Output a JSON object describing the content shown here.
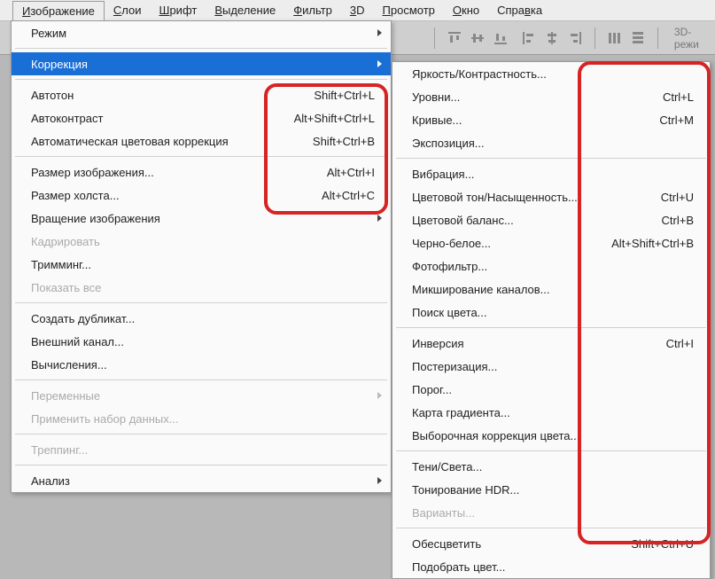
{
  "menubar": {
    "items": [
      {
        "pre": "",
        "u": "И",
        "post": "зображение"
      },
      {
        "pre": "",
        "u": "С",
        "post": "лои"
      },
      {
        "pre": "",
        "u": "Ш",
        "post": "рифт"
      },
      {
        "pre": "",
        "u": "В",
        "post": "ыделение"
      },
      {
        "pre": "",
        "u": "Ф",
        "post": "ильтр"
      },
      {
        "pre": "",
        "u": "3",
        "post": "D"
      },
      {
        "pre": "",
        "u": "П",
        "post": "росмотр"
      },
      {
        "pre": "",
        "u": "О",
        "post": "кно"
      },
      {
        "pre": "Спра",
        "u": "в",
        "post": "ка"
      }
    ]
  },
  "toolbar": {
    "mode3d": "3D-режи"
  },
  "main_menu": [
    {
      "type": "item",
      "label": "Режим",
      "arrow": true
    },
    {
      "type": "sep"
    },
    {
      "type": "item",
      "label": "Коррекция",
      "arrow": true,
      "highlight": true
    },
    {
      "type": "sep"
    },
    {
      "type": "item",
      "label": "Автотон",
      "shortcut": "Shift+Ctrl+L"
    },
    {
      "type": "item",
      "label": "Автоконтраст",
      "shortcut": "Alt+Shift+Ctrl+L"
    },
    {
      "type": "item",
      "label": "Автоматическая цветовая коррекция",
      "shortcut": "Shift+Ctrl+B"
    },
    {
      "type": "sep"
    },
    {
      "type": "item",
      "label": "Размер изображения...",
      "shortcut": "Alt+Ctrl+I"
    },
    {
      "type": "item",
      "label": "Размер холста...",
      "shortcut": "Alt+Ctrl+C"
    },
    {
      "type": "item",
      "label": "Вращение изображения",
      "arrow": true
    },
    {
      "type": "item",
      "label": "Кадрировать",
      "disabled": true
    },
    {
      "type": "item",
      "label": "Тримминг..."
    },
    {
      "type": "item",
      "label": "Показать все",
      "disabled": true
    },
    {
      "type": "sep"
    },
    {
      "type": "item",
      "label": "Создать дубликат..."
    },
    {
      "type": "item",
      "label": "Внешний канал..."
    },
    {
      "type": "item",
      "label": "Вычисления..."
    },
    {
      "type": "sep"
    },
    {
      "type": "item",
      "label": "Переменные",
      "arrow": true,
      "disabled": true
    },
    {
      "type": "item",
      "label": "Применить набор данных...",
      "disabled": true
    },
    {
      "type": "sep"
    },
    {
      "type": "item",
      "label": "Треппинг...",
      "disabled": true
    },
    {
      "type": "sep"
    },
    {
      "type": "item",
      "label": "Анализ",
      "arrow": true
    }
  ],
  "sub_menu": [
    {
      "type": "item",
      "label": "Яркость/Контрастность..."
    },
    {
      "type": "item",
      "label": "Уровни...",
      "shortcut": "Ctrl+L"
    },
    {
      "type": "item",
      "label": "Кривые...",
      "shortcut": "Ctrl+M"
    },
    {
      "type": "item",
      "label": "Экспозиция..."
    },
    {
      "type": "sep"
    },
    {
      "type": "item",
      "label": "Вибрация..."
    },
    {
      "type": "item",
      "label": "Цветовой тон/Насыщенность...",
      "shortcut": "Ctrl+U"
    },
    {
      "type": "item",
      "label": "Цветовой баланс...",
      "shortcut": "Ctrl+B"
    },
    {
      "type": "item",
      "label": "Черно-белое...",
      "shortcut": "Alt+Shift+Ctrl+B"
    },
    {
      "type": "item",
      "label": "Фотофильтр..."
    },
    {
      "type": "item",
      "label": "Микширование каналов..."
    },
    {
      "type": "item",
      "label": "Поиск цвета..."
    },
    {
      "type": "sep"
    },
    {
      "type": "item",
      "label": "Инверсия",
      "shortcut": "Ctrl+I"
    },
    {
      "type": "item",
      "label": "Постеризация..."
    },
    {
      "type": "item",
      "label": "Порог..."
    },
    {
      "type": "item",
      "label": "Карта градиента..."
    },
    {
      "type": "item",
      "label": "Выборочная коррекция цвета..."
    },
    {
      "type": "sep"
    },
    {
      "type": "item",
      "label": "Тени/Света..."
    },
    {
      "type": "item",
      "label": "Тонирование HDR..."
    },
    {
      "type": "item",
      "label": "Варианты...",
      "disabled": true
    },
    {
      "type": "sep"
    },
    {
      "type": "item",
      "label": "Обесцветить",
      "shortcut": "Shift+Ctrl+U"
    },
    {
      "type": "item",
      "label": "Подобрать цвет..."
    }
  ]
}
